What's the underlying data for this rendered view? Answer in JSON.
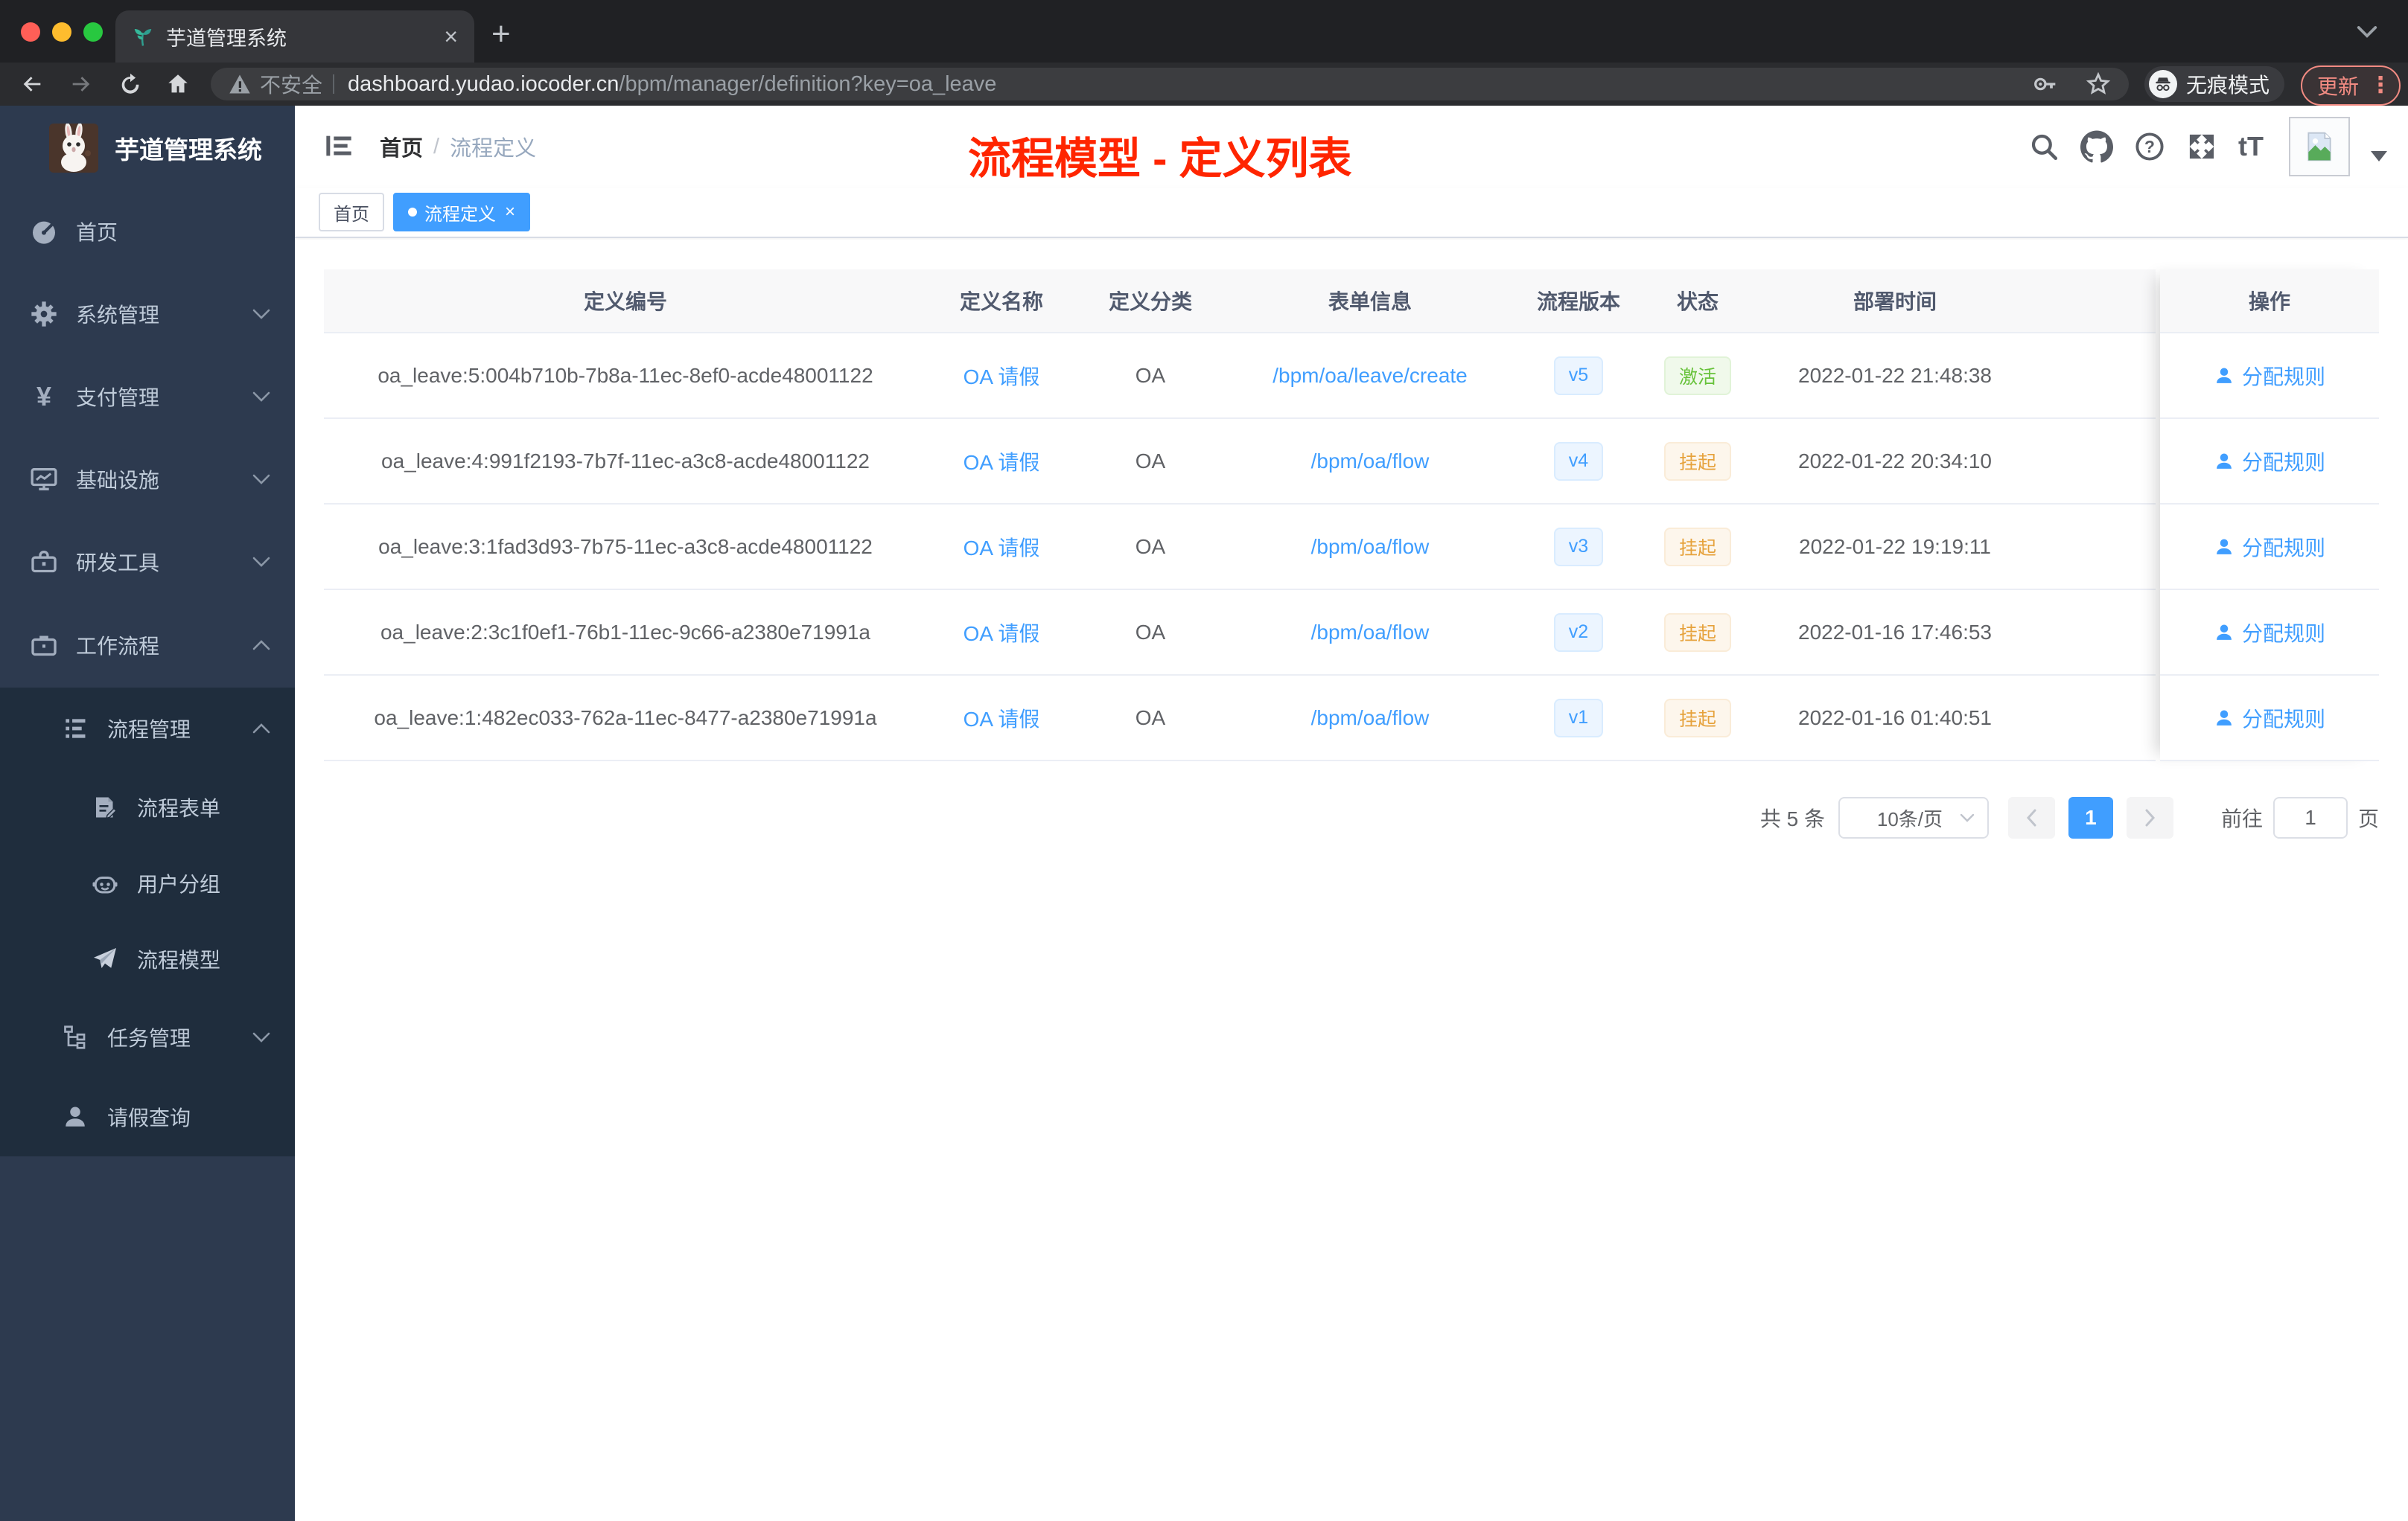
{
  "browser": {
    "tab": {
      "title": "芋道管理系统"
    },
    "address": {
      "security": "不安全",
      "host": "dashboard.yudao.iocoder.cn",
      "path": "/bpm/manager/definition?key=oa_leave"
    },
    "incognito_label": "无痕模式",
    "update_label": "更新"
  },
  "glyphs": {
    "close": "×",
    "plus": "+",
    "more": "⋮",
    "yen": "¥",
    "font_size": "tT"
  },
  "sidebar": {
    "app_title": "芋道管理系统",
    "items": [
      {
        "label": "首页",
        "icon": "dashboard-icon"
      },
      {
        "label": "系统管理",
        "icon": "gear-icon"
      },
      {
        "label": "支付管理",
        "icon": "yen-icon"
      },
      {
        "label": "基础设施",
        "icon": "monitor-icon"
      },
      {
        "label": "研发工具",
        "icon": "toolbox-icon"
      },
      {
        "label": "工作流程",
        "icon": "briefcase-icon"
      },
      {
        "label": "流程管理",
        "icon": "list-icon"
      },
      {
        "label": "流程表单",
        "icon": "form-icon"
      },
      {
        "label": "用户分组",
        "icon": "robot-icon"
      },
      {
        "label": "流程模型",
        "icon": "paper-plane-icon"
      },
      {
        "label": "任务管理",
        "icon": "tree-icon"
      },
      {
        "label": "请假查询",
        "icon": "user-icon"
      }
    ]
  },
  "navbar": {
    "breadcrumb": {
      "home": "首页",
      "separator": "/",
      "current": "流程定义"
    }
  },
  "annotation": "流程模型 - 定义列表",
  "tags": {
    "home": "首页",
    "active": "流程定义"
  },
  "table": {
    "columns": {
      "id": "定义编号",
      "name": "定义名称",
      "category": "定义分类",
      "form": "表单信息",
      "version": "流程版本",
      "status": "状态",
      "deploy_time": "部署时间",
      "actions": "操作"
    },
    "rows": [
      {
        "id": "oa_leave:5:004b710b-7b8a-11ec-8ef0-acde48001122",
        "name": "OA 请假",
        "category": "OA",
        "form": "/bpm/oa/leave/create",
        "version": "v5",
        "status": "激活",
        "time": "2022-01-22 21:48:38",
        "action": "分配规则"
      },
      {
        "id": "oa_leave:4:991f2193-7b7f-11ec-a3c8-acde48001122",
        "name": "OA 请假",
        "category": "OA",
        "form": "/bpm/oa/flow",
        "version": "v4",
        "status": "挂起",
        "time": "2022-01-22 20:34:10",
        "action": "分配规则"
      },
      {
        "id": "oa_leave:3:1fad3d93-7b75-11ec-a3c8-acde48001122",
        "name": "OA 请假",
        "category": "OA",
        "form": "/bpm/oa/flow",
        "version": "v3",
        "status": "挂起",
        "time": "2022-01-22 19:19:11",
        "action": "分配规则"
      },
      {
        "id": "oa_leave:2:3c1f0ef1-76b1-11ec-9c66-a2380e71991a",
        "name": "OA 请假",
        "category": "OA",
        "form": "/bpm/oa/flow",
        "version": "v2",
        "status": "挂起",
        "time": "2022-01-16 17:46:53",
        "action": "分配规则"
      },
      {
        "id": "oa_leave:1:482ec033-762a-11ec-8477-a2380e71991a",
        "name": "OA 请假",
        "category": "OA",
        "form": "/bpm/oa/flow",
        "version": "v1",
        "status": "挂起",
        "time": "2022-01-16 01:40:51",
        "action": "分配规则"
      }
    ]
  },
  "pagination": {
    "total": "共 5 条",
    "page_size": "10条/页",
    "page": "1",
    "goto_label": "前往",
    "goto_value": "1",
    "unit": "页"
  },
  "colors": {
    "accent": "#409eff",
    "success": "#67c23a",
    "warning": "#e6a23c",
    "annotation": "#ff2500"
  }
}
